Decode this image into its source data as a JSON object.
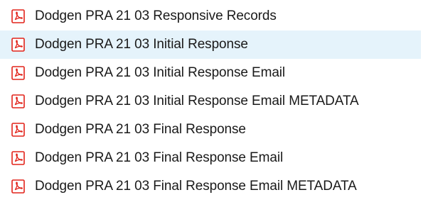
{
  "file_list": {
    "items": [
      {
        "name": "Dodgen PRA 21 03 Responsive Records",
        "icon": "pdf-file-icon",
        "selected": false
      },
      {
        "name": "Dodgen PRA 21 03 Initial Response",
        "icon": "pdf-file-icon",
        "selected": true
      },
      {
        "name": "Dodgen PRA 21 03 Initial Response Email",
        "icon": "pdf-file-icon",
        "selected": false
      },
      {
        "name": "Dodgen PRA 21 03 Initial Response Email METADATA",
        "icon": "pdf-file-icon",
        "selected": false
      },
      {
        "name": "Dodgen PRA 21 03 Final Response",
        "icon": "pdf-file-icon",
        "selected": false
      },
      {
        "name": "Dodgen PRA 21 03 Final Response Email",
        "icon": "pdf-file-icon",
        "selected": false
      },
      {
        "name": "Dodgen PRA 21 03 Final Response Email METADATA",
        "icon": "pdf-file-icon",
        "selected": false
      }
    ],
    "colors": {
      "selection_bg": "#e5f3fb",
      "icon_red": "#e2231a",
      "text": "#1a1a1a"
    }
  }
}
